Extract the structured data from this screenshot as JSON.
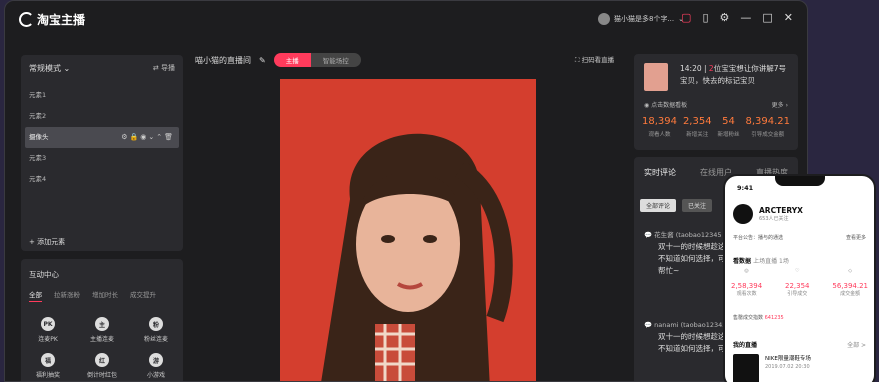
{
  "app": {
    "name": "淘宝主播",
    "user": "猫小猫是多8个字..."
  },
  "left": {
    "mode": "常规模式",
    "switch": "导播",
    "elements": [
      "元素1",
      "元素2",
      "摄像头",
      "元素3",
      "元素4"
    ],
    "add": "添加元素"
  },
  "interact": {
    "title": "互动中心",
    "tabs": [
      "全部",
      "拉新涨粉",
      "增加时长",
      "成交提升"
    ],
    "items": [
      {
        "icon": "PK",
        "label": "连麦PK"
      },
      {
        "icon": "主",
        "label": "主播连麦"
      },
      {
        "icon": "粉",
        "label": "粉丝连麦"
      },
      {
        "icon": "福",
        "label": "福利抽奖"
      },
      {
        "icon": "红",
        "label": "倒计时红包"
      },
      {
        "icon": "游",
        "label": "小游戏"
      }
    ]
  },
  "stage": {
    "room": "喵小猫的直播间",
    "tabs": [
      "主播",
      "智能场控"
    ],
    "scan": "扫码看直播"
  },
  "info": {
    "time": "14:20",
    "count": "2",
    "notice_a": "位宝宝想让你讲解7号",
    "notice_b": "宝贝，快去的标记宝贝",
    "link": "点击数据看板",
    "more": "更多",
    "stats": [
      {
        "value": "18,394",
        "label": "观看人数"
      },
      {
        "value": "2,354",
        "label": "新增关注"
      },
      {
        "value": "54",
        "label": "新增粉丝"
      },
      {
        "value": "8,394.21",
        "label": "引导成交金额"
      }
    ]
  },
  "comments": {
    "tabs": [
      "实时评论",
      "在线用户",
      "直播热度"
    ],
    "chips": [
      "全部评论",
      "已关注"
    ],
    "list": [
      {
        "user": "花生酱 (taobao12345",
        "text_a": "双十一的时候想趁这",
        "text_b": "不知道如何选择，可",
        "text_c": "帮忙~"
      },
      {
        "user": "nanami (taobao12345",
        "text_a": "双十一的时候想趁这",
        "text_b": "不知道如何选择，可",
        "text_c": ""
      }
    ]
  },
  "phone": {
    "time": "9:41",
    "brand": "ARCTERYX",
    "sub": "653人已关注",
    "notice": "平台公告：播与的通选",
    "notice_link": "查看更多",
    "data_title": "看数据",
    "data_sub": "上场直播 1场",
    "stats": [
      {
        "label": "观看次数",
        "value": "2,58,394"
      },
      {
        "label": "引导成交",
        "value": "22,354"
      },
      {
        "label": "成交金额",
        "value": "56,394.21"
      }
    ],
    "sales_label": "售罄成交指数",
    "sales_value": "641235",
    "live_title": "我的直播",
    "live_more": "全部 >",
    "card_title": "NIKE限量潮鞋专场",
    "card_date": "2019.07.02 20:30"
  },
  "colors": {
    "accent": "#ff3b5c",
    "stat": "#ff7a3c",
    "video_bg": "#d43e2e"
  }
}
